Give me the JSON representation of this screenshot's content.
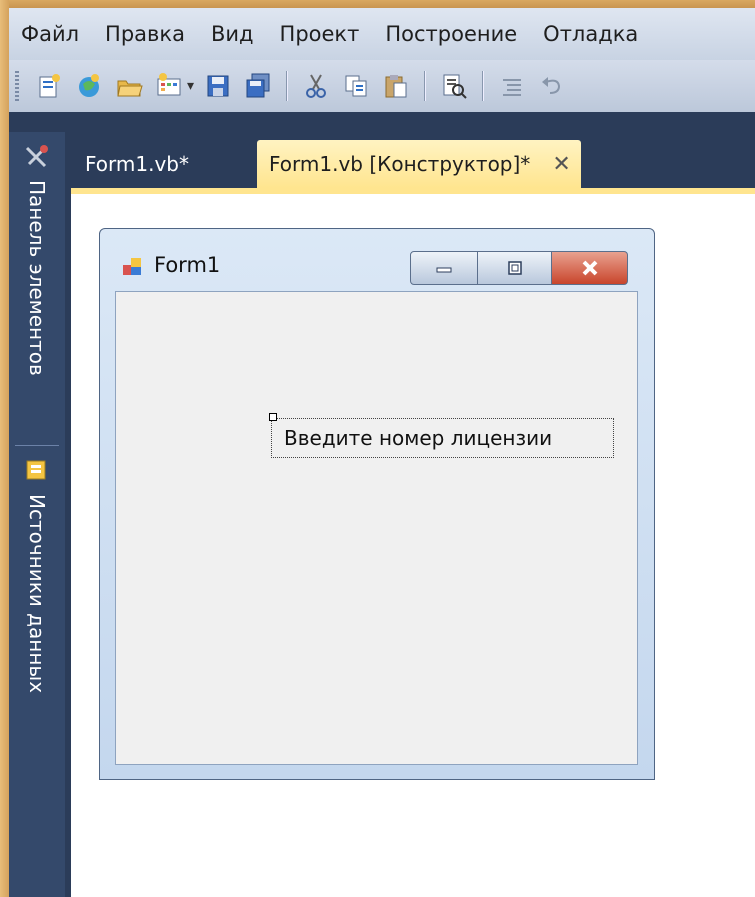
{
  "menu": [
    "Файл",
    "Правка",
    "Вид",
    "Проект",
    "Построение",
    "Отладка"
  ],
  "toolbar_icons": [
    "new-project-icon",
    "web-site-icon",
    "open-folder-icon",
    "add-item-icon",
    "save-icon",
    "save-all-icon",
    "cut-icon",
    "copy-icon",
    "paste-icon",
    "find-icon",
    "indent-icon",
    "undo-icon"
  ],
  "side_panel": {
    "toolbox_label": "Панель элементов",
    "datasources_label": "Источники данных"
  },
  "tabs": [
    {
      "label": "Form1.vb*",
      "active": false
    },
    {
      "label": "Form1.vb [Конструктор]*",
      "active": true
    }
  ],
  "form": {
    "title": "Form1",
    "label_text": "Введите номер лицензии"
  },
  "colors": {
    "accent": "#ffe58f",
    "ide_bg": "#2b3c59",
    "close": "#c8452c"
  }
}
